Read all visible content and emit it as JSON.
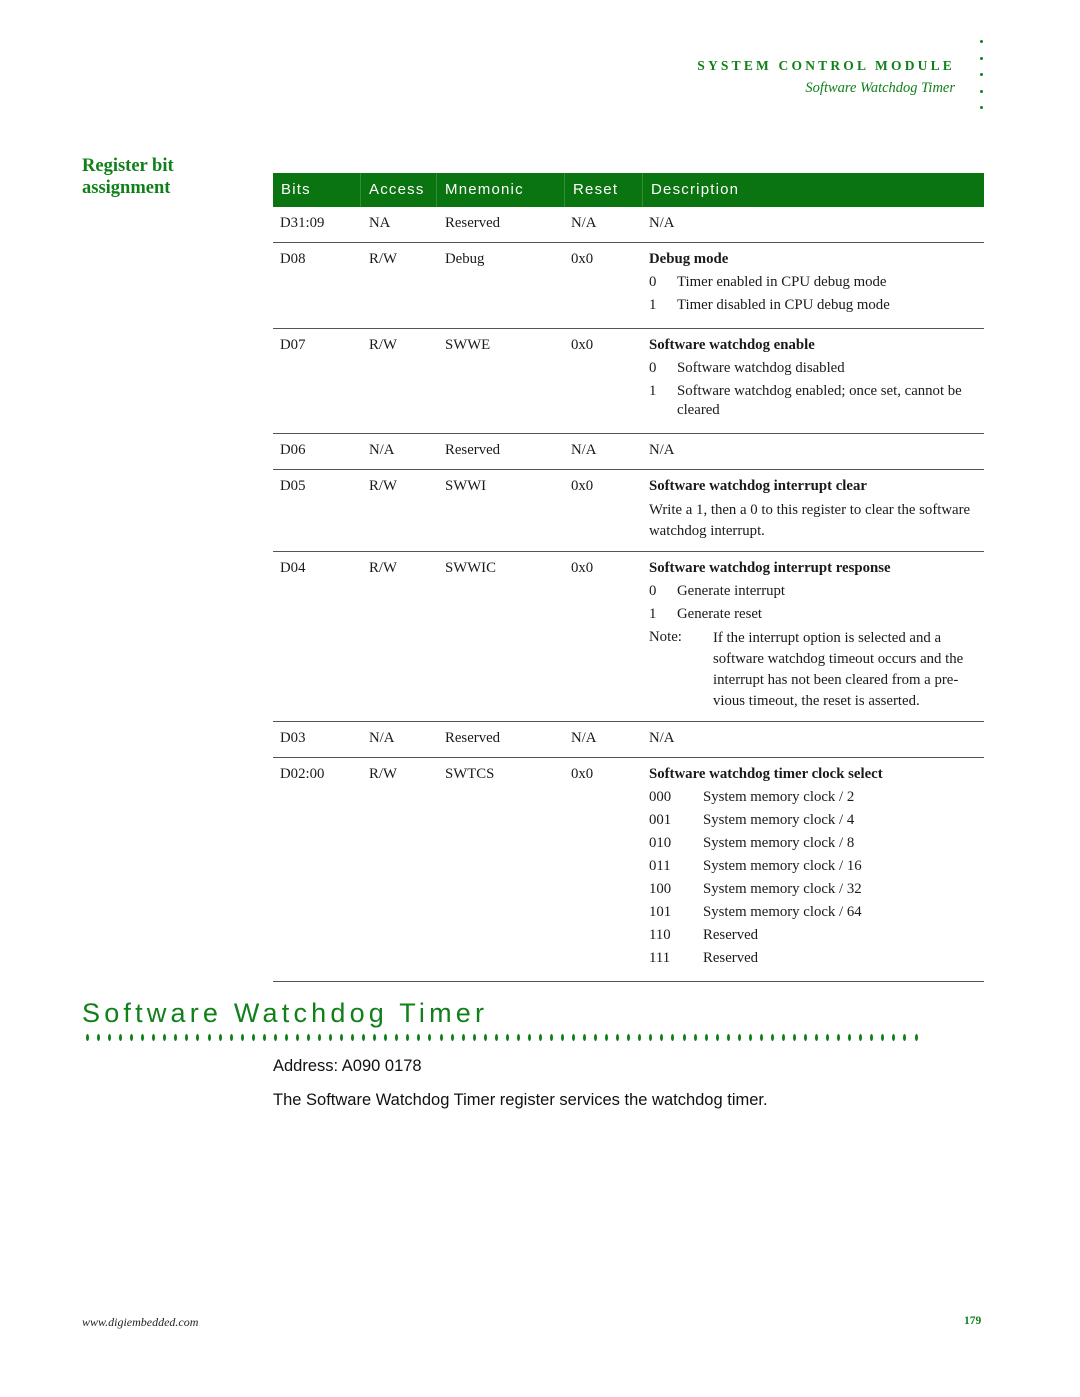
{
  "running_header": {
    "chapter": "SYSTEM CONTROL MODULE",
    "section": "Software Watchdog Timer"
  },
  "side_heading": {
    "line1": "Register bit",
    "line2": "assignment"
  },
  "table": {
    "headers": [
      "Bits",
      "Access",
      "Mnemonic",
      "Reset",
      "Description"
    ],
    "rows": [
      {
        "bits": "D31:09",
        "access": "NA",
        "mnemonic": "Reserved",
        "reset": "N/A",
        "desc_plain": "N/A"
      },
      {
        "bits": "D08",
        "access": "R/W",
        "mnemonic": "Debug",
        "reset": "0x0",
        "desc_title": "Debug mode",
        "options": [
          {
            "k": "0",
            "v": "Timer enabled in CPU debug mode"
          },
          {
            "k": "1",
            "v": "Timer disabled in CPU debug mode"
          }
        ]
      },
      {
        "bits": "D07",
        "access": "R/W",
        "mnemonic": "SWWE",
        "reset": "0x0",
        "desc_title": "Software watchdog enable",
        "options": [
          {
            "k": "0",
            "v": "Software watchdog disabled"
          },
          {
            "k": "1",
            "v": "Software watchdog enabled; once set, cannot be cleared"
          }
        ]
      },
      {
        "bits": "D06",
        "access": "N/A",
        "mnemonic": "Reserved",
        "reset": "N/A",
        "desc_plain": "N/A"
      },
      {
        "bits": "D05",
        "access": "R/W",
        "mnemonic": "SWWI",
        "reset": "0x0",
        "desc_title": "Software watchdog interrupt clear",
        "desc_text": "Write a 1, then a 0 to this register to clear the software watchdog interrupt."
      },
      {
        "bits": "D04",
        "access": "R/W",
        "mnemonic": "SWWIC",
        "reset": "0x0",
        "desc_title": "Software watchdog interrupt response",
        "options": [
          {
            "k": "0",
            "v": "Generate interrupt"
          },
          {
            "k": "1",
            "v": "Generate reset"
          }
        ],
        "note_label": "Note:",
        "note_text": "If the interrupt option is selected and a software watchdog timeout occurs and the interrupt has not been cleared from a pre-vious timeout, the reset is asserted."
      },
      {
        "bits": "D03",
        "access": "N/A",
        "mnemonic": "Reserved",
        "reset": "N/A",
        "desc_plain": "N/A"
      },
      {
        "bits": "D02:00",
        "access": "R/W",
        "mnemonic": "SWTCS",
        "reset": "0x0",
        "desc_title": "Software watchdog timer clock select",
        "options3": [
          {
            "k": "000",
            "v": "System memory clock / 2"
          },
          {
            "k": "001",
            "v": "System memory clock / 4"
          },
          {
            "k": "010",
            "v": "System memory clock / 8"
          },
          {
            "k": "011",
            "v": "System memory clock / 16"
          },
          {
            "k": "100",
            "v": "System memory clock / 32"
          },
          {
            "k": "101",
            "v": "System memory clock / 64"
          },
          {
            "k": "110",
            "v": "Reserved"
          },
          {
            "k": "111",
            "v": "Reserved"
          }
        ]
      }
    ]
  },
  "section": {
    "title": "Software Watchdog Timer",
    "address": "Address: A090 0178",
    "intro": "The Software Watchdog Timer register services the watchdog timer."
  },
  "footer": {
    "url": "www.digiembedded.com",
    "page": "179"
  },
  "colors": {
    "accent": "#11801a",
    "header_bg": "#0a7410"
  }
}
